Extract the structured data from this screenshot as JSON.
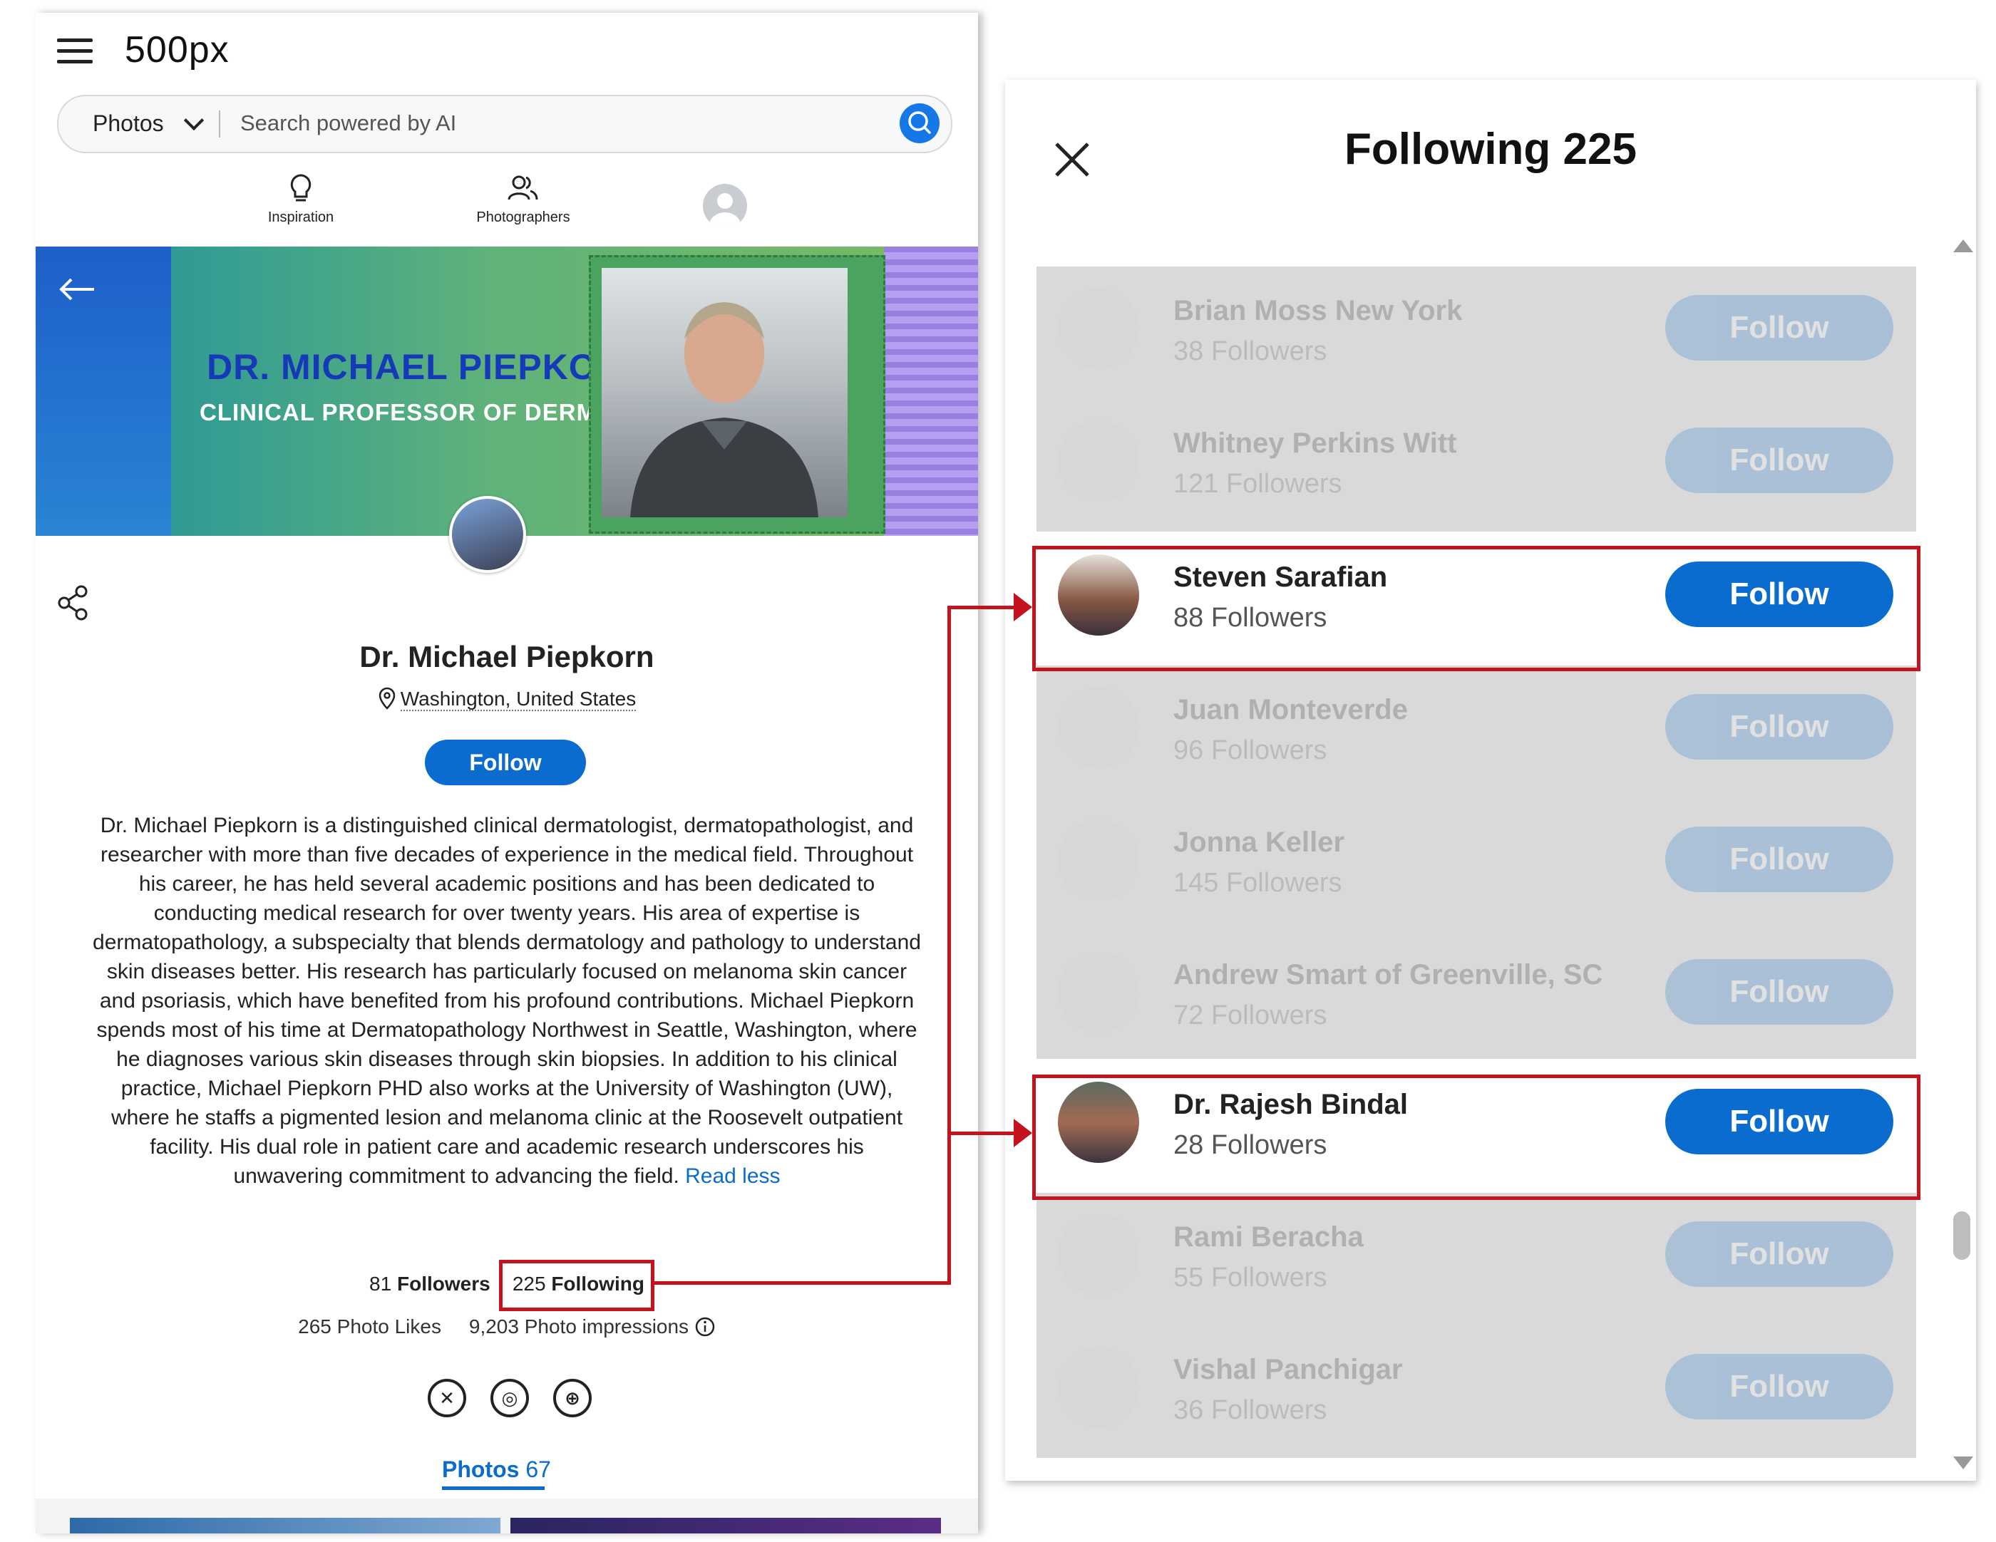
{
  "app": {
    "logo": "500px"
  },
  "search": {
    "category": "Photos",
    "placeholder": "Search powered by AI"
  },
  "nav": {
    "inspiration": "Inspiration",
    "photographers": "Photographers"
  },
  "banner": {
    "name": "DR. MICHAEL PIEPKORN",
    "title": "CLINICAL PROFESSOR OF DERMATOLOGY"
  },
  "profile": {
    "name": "Dr. Michael Piepkorn",
    "location": "Washington, United States",
    "follow_label": "Follow",
    "bio": "Dr. Michael Piepkorn is a distinguished clinical dermatologist, dermatopathologist, and researcher with more than five decades of experience in the medical field. Throughout his career, he has held several academic positions and has been dedicated to conducting medical research for over twenty years. His area of expertise is dermatopathology, a subspecialty that blends dermatology and pathology to understand skin diseases better. His research has particularly focused on melanoma skin cancer and psoriasis, which have benefited from his profound contributions. Michael Piepkorn spends most of his time at Dermatopathology Northwest in Seattle, Washington, where he diagnoses various skin diseases through skin biopsies. In addition to his clinical practice, Michael Piepkorn PHD also works at the University of Washington (UW), where he staffs a pigmented lesion and melanoma clinic at the Roosevelt outpatient facility. His dual role in patient care and academic research underscores his unwavering commitment to advancing the field.",
    "read_less": "Read less",
    "followers_count": "81",
    "followers_label": "Followers",
    "following_count": "225",
    "following_label": "Following",
    "photo_likes": "265 Photo Likes",
    "photo_impressions": "9,203 Photo impressions",
    "tab_photos_label": "Photos",
    "tab_photos_count": "67"
  },
  "dialog": {
    "title": "Following 225",
    "users": [
      {
        "name": "Brian Moss New York",
        "followers": "38 Followers",
        "button": "Follow",
        "highlighted": false
      },
      {
        "name": "Whitney Perkins Witt",
        "followers": "121 Followers",
        "button": "Follow",
        "highlighted": false
      },
      {
        "name": "Steven Sarafian",
        "followers": "88 Followers",
        "button": "Follow",
        "highlighted": true
      },
      {
        "name": "Juan Monteverde",
        "followers": "96 Followers",
        "button": "Follow",
        "highlighted": false
      },
      {
        "name": "Jonna Keller",
        "followers": "145 Followers",
        "button": "Follow",
        "highlighted": false
      },
      {
        "name": "Andrew Smart of Greenville, SC",
        "followers": "72 Followers",
        "button": "Follow",
        "highlighted": false
      },
      {
        "name": "Dr. Rajesh Bindal",
        "followers": "28 Followers",
        "button": "Follow",
        "highlighted": true
      },
      {
        "name": "Rami Beracha",
        "followers": "55 Followers",
        "button": "Follow",
        "highlighted": false
      },
      {
        "name": "Vishal Panchigar",
        "followers": "36 Followers",
        "button": "Follow",
        "highlighted": false
      }
    ]
  },
  "colors": {
    "accent": "#0a6ccf",
    "highlight": "#c4121f"
  }
}
